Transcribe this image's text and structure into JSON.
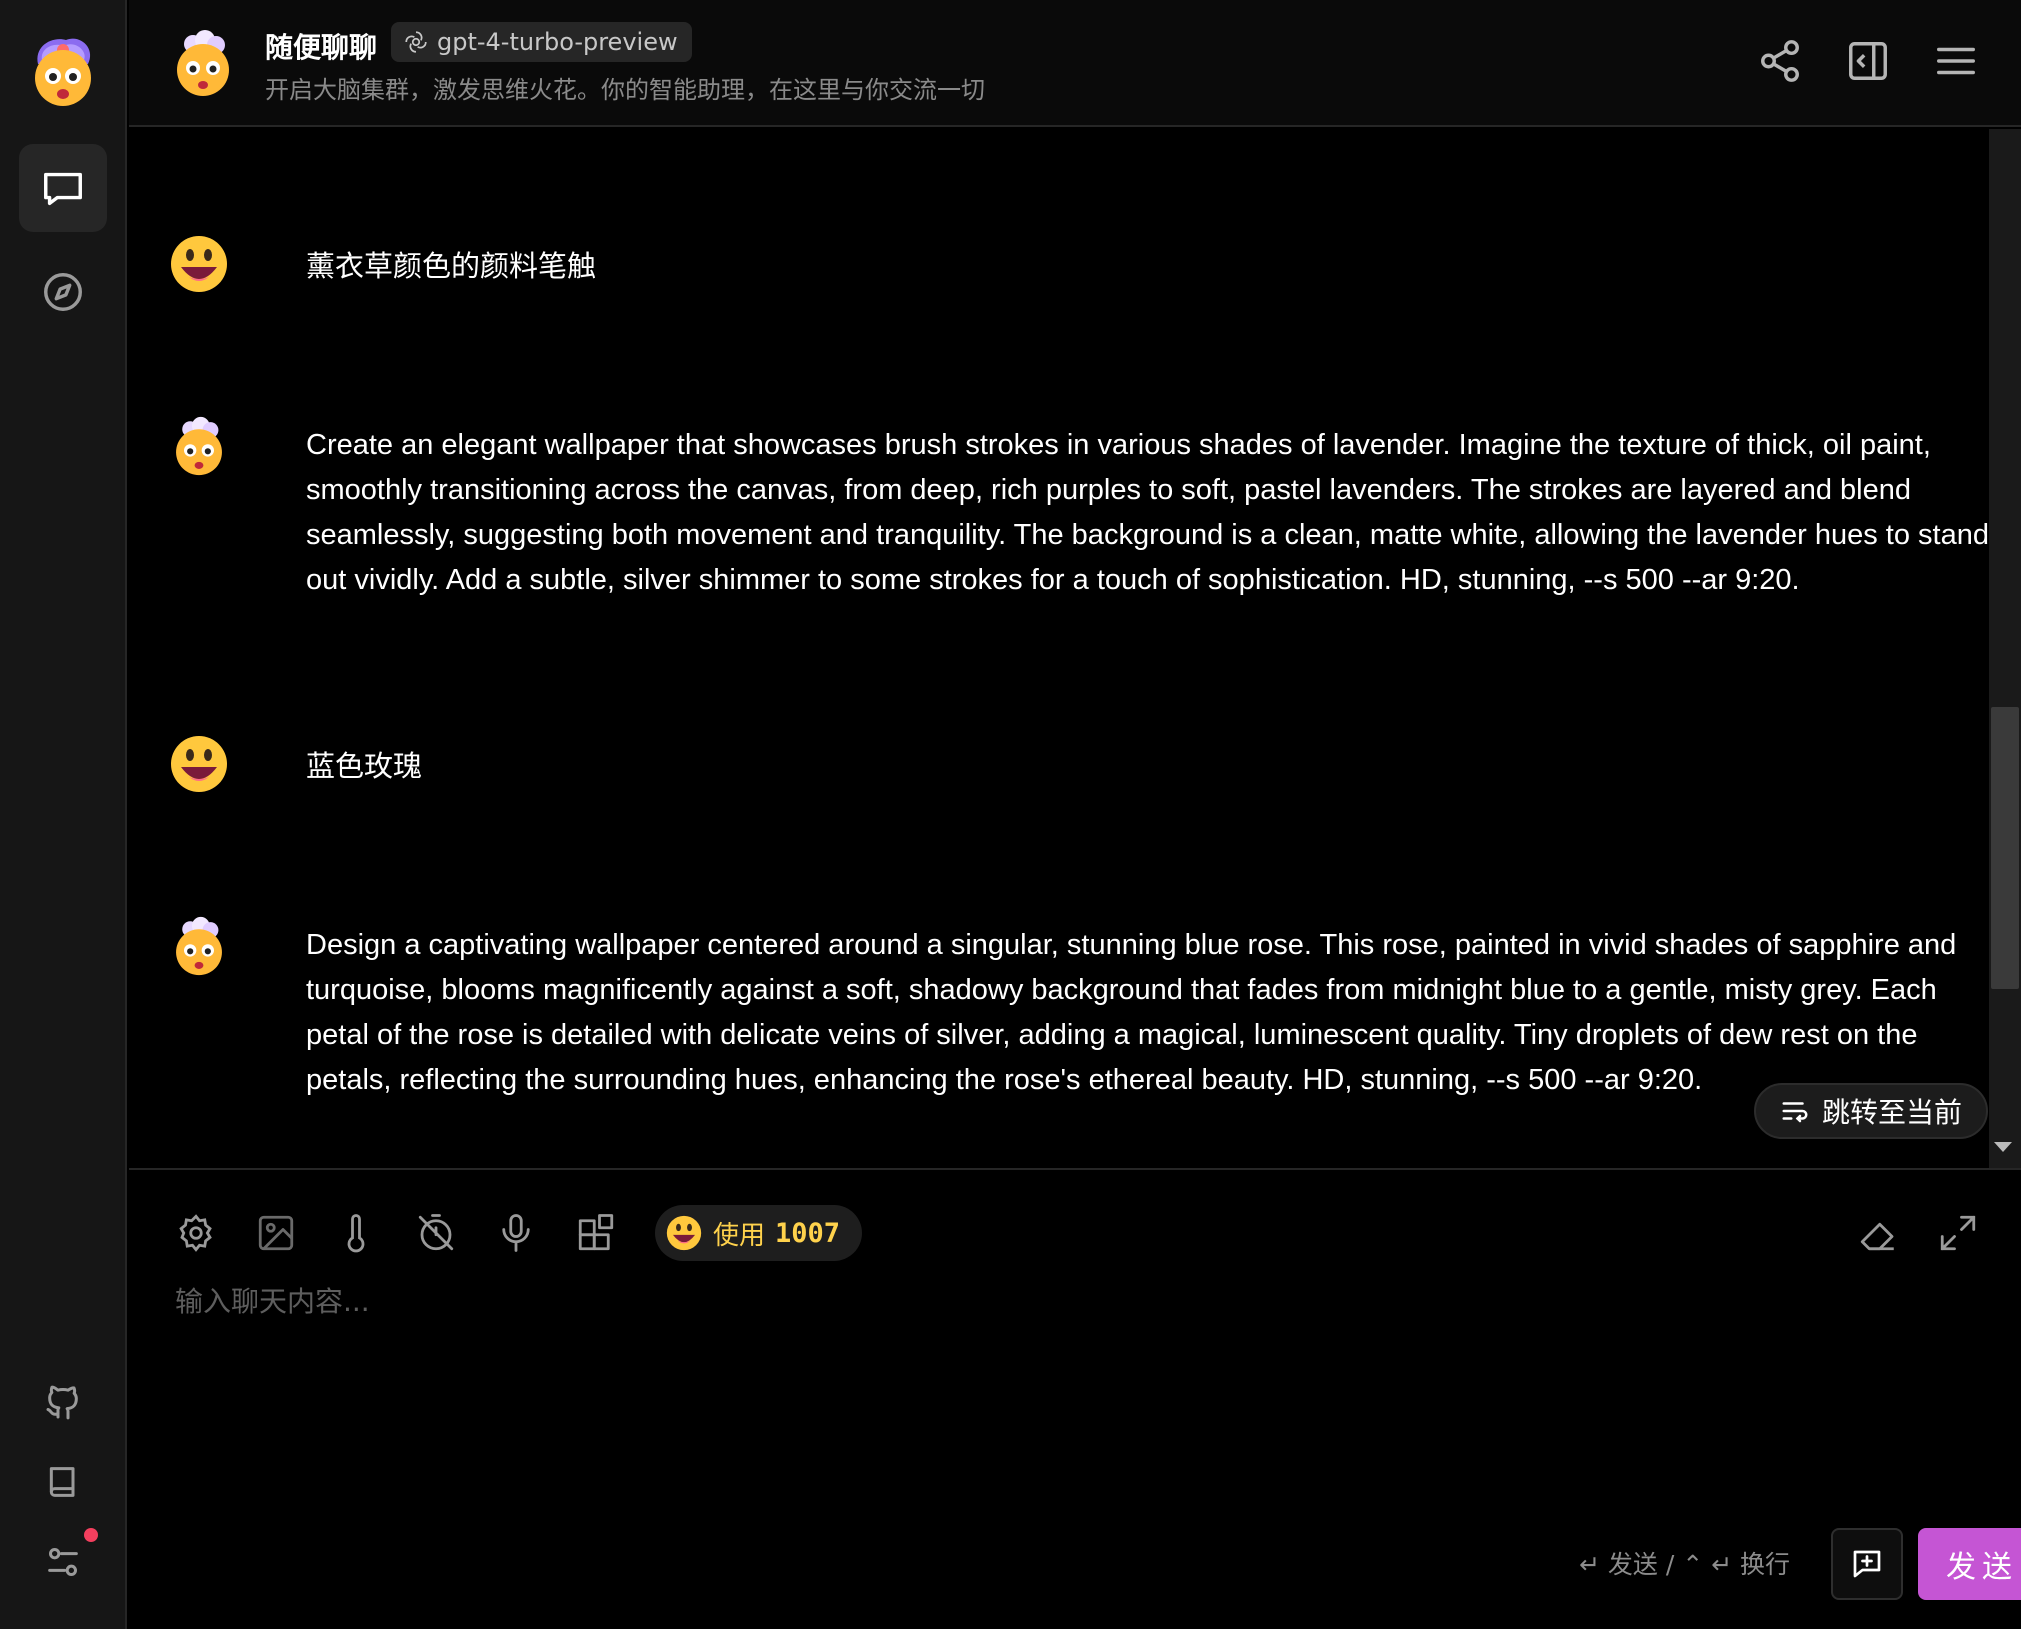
{
  "header": {
    "title": "随便聊聊",
    "model": "gpt-4-turbo-preview",
    "subtitle": "开启大脑集群，激发思维火花。你的智能助理，在这里与你交流一切"
  },
  "messages": [
    {
      "role": "user",
      "text": "薰衣草颜色的颜料笔触"
    },
    {
      "role": "assistant",
      "text": "Create an elegant wallpaper that showcases brush strokes in various shades of lavender. Imagine the texture of thick, oil paint, smoothly transitioning across the canvas, from deep, rich purples to soft, pastel lavenders. The strokes are layered and blend seamlessly, suggesting both movement and tranquility. The background is a clean, matte white, allowing the lavender hues to stand out vividly. Add a subtle, silver shimmer to some strokes for a touch of sophistication. HD, stunning, --s 500 --ar 9:20."
    },
    {
      "role": "user",
      "text": "蓝色玫瑰"
    },
    {
      "role": "assistant",
      "text": "Design a captivating wallpaper centered around a singular, stunning blue rose. This rose, painted in vivid shades of sapphire and turquoise, blooms magnificently against a soft, shadowy background that fades from midnight blue to a gentle, misty grey. Each petal of the rose is detailed with delicate veins of silver, adding a magical, luminescent quality. Tiny droplets of dew rest on the petals, reflecting the surrounding hues, enhancing the rose's ethereal beauty. HD, stunning, --s 500 --ar 9:20."
    }
  ],
  "jump_label": "跳转至当前",
  "input": {
    "placeholder": "输入聊天内容...",
    "usage_label": "使用",
    "usage_count": "1007",
    "hint": "↵ 发送 / ⌃ ↵ 换行",
    "send_label": "发送"
  },
  "colors": {
    "accent": "#c555d4",
    "usage": "#ffd24c",
    "badge": "#f43f5e"
  }
}
